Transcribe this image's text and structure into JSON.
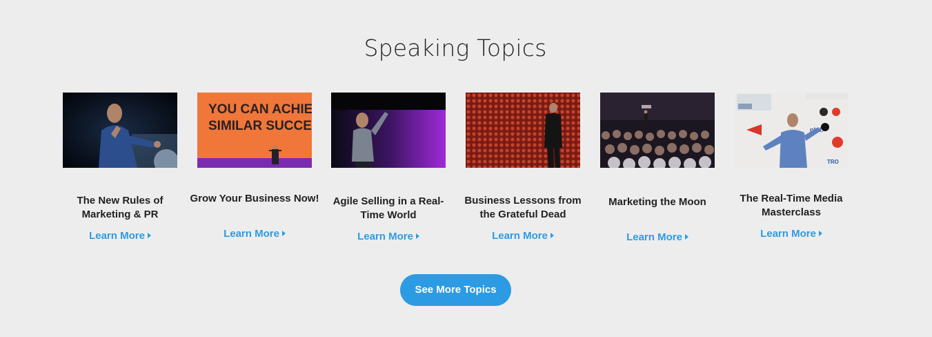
{
  "section": {
    "title": "Speaking Topics",
    "see_more_label": "See More Topics"
  },
  "topics": [
    {
      "title": "The New Rules of Marketing & PR",
      "link": "Learn More",
      "image": "speaker-on-stage-photo"
    },
    {
      "title": "Grow Your Business Now!",
      "link": "Learn More",
      "image": "slide-you-can-achieve-photo",
      "slide_text": "YOU CAN ACHIEVE SIMILAR SUCCESS."
    },
    {
      "title": "Agile Selling in a Real-Time World",
      "link": "Learn More",
      "image": "speaker-purple-stage-photo"
    },
    {
      "title": "Business Lessons from the Grateful Dead",
      "link": "Learn More",
      "image": "speaker-red-backdrop-photo"
    },
    {
      "title": "Marketing the Moon",
      "link": "Learn More",
      "image": "audience-photo"
    },
    {
      "title": "The Real-Time Media Masterclass",
      "link": "Learn More",
      "image": "speaker-with-logos-photo"
    }
  ],
  "colors": {
    "accent": "#2d9be3",
    "background": "#ededed",
    "text": "#222222"
  },
  "icons": {
    "link_caret": "caret-right-icon"
  }
}
